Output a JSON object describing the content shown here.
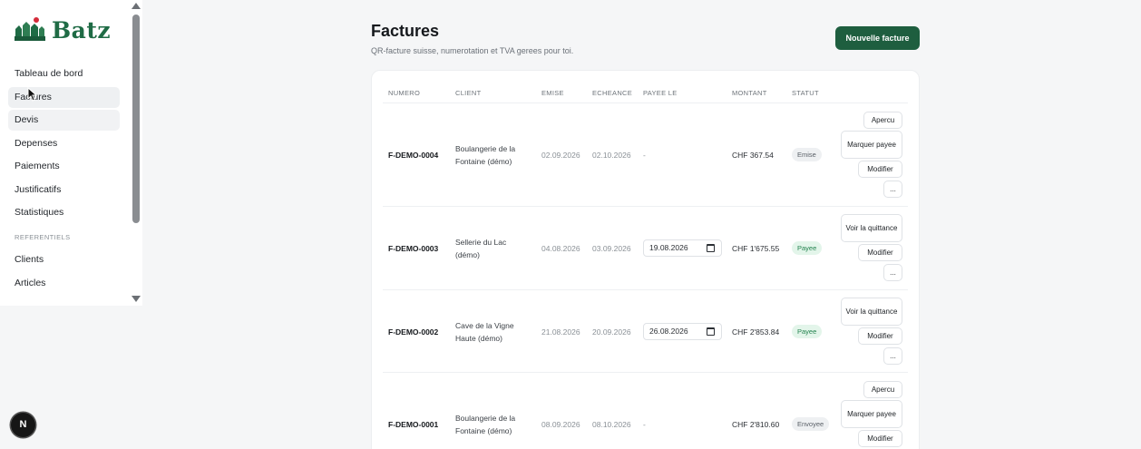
{
  "brand": {
    "name": "Batz",
    "color": "#1f6b45"
  },
  "sidebar": {
    "items": [
      {
        "label": "Tableau de bord"
      },
      {
        "label": "Factures"
      },
      {
        "label": "Devis"
      },
      {
        "label": "Depenses"
      },
      {
        "label": "Paiements"
      },
      {
        "label": "Justificatifs"
      },
      {
        "label": "Statistiques"
      }
    ],
    "section_label": "REFERENTIELS",
    "section_items": [
      {
        "label": "Clients"
      },
      {
        "label": "Articles"
      }
    ]
  },
  "badge": {
    "letter": "N"
  },
  "page": {
    "title": "Factures",
    "subtitle": "QR-facture suisse, numerotation et TVA gerees pour toi.",
    "new_button": "Nouvelle facture"
  },
  "table": {
    "headers": {
      "numero": "NUMERO",
      "client": "CLIENT",
      "emise": "EMISE",
      "echeance": "ECHEANCE",
      "payee_le": "PAYEE LE",
      "montant": "MONTANT",
      "statut": "STATUT"
    },
    "rows": [
      {
        "numero": "F-DEMO-0004",
        "client": "Boulangerie de la Fontaine (démo)",
        "emise": "02.09.2026",
        "echeance": "02.10.2026",
        "payee_le": "-",
        "montant": "CHF 367.54",
        "statut": "Emise",
        "actions": [
          "Apercu",
          "Marquer payee",
          "Modifier",
          "..."
        ]
      },
      {
        "numero": "F-DEMO-0003",
        "client": "Sellerie du Lac (démo)",
        "emise": "04.08.2026",
        "echeance": "03.09.2026",
        "payee_le": "19.08.2026",
        "montant": "CHF 1'675.55",
        "statut": "Payee",
        "actions": [
          "Voir la quittance",
          "Modifier",
          "..."
        ]
      },
      {
        "numero": "F-DEMO-0002",
        "client": "Cave de la Vigne Haute (démo)",
        "emise": "21.08.2026",
        "echeance": "20.09.2026",
        "payee_le": "26.08.2026",
        "montant": "CHF 2'853.84",
        "statut": "Payee",
        "actions": [
          "Voir la quittance",
          "Modifier",
          "..."
        ]
      },
      {
        "numero": "F-DEMO-0001",
        "client": "Boulangerie de la Fontaine (démo)",
        "emise": "08.09.2026",
        "echeance": "08.10.2026",
        "payee_le": "-",
        "montant": "CHF 2'810.60",
        "statut": "Envoyee",
        "actions": [
          "Apercu",
          "Marquer payee",
          "Modifier"
        ]
      }
    ]
  }
}
